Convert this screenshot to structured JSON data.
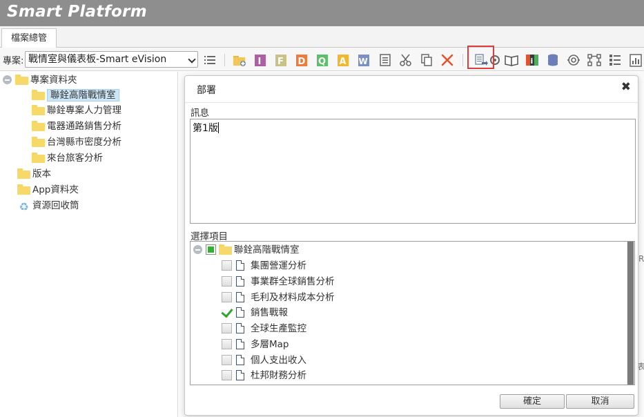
{
  "app": {
    "title": "Smart Platform"
  },
  "tabs": [
    {
      "label": "檔案總管"
    }
  ],
  "toolbar": {
    "project_label": "專案:",
    "project_value": "戰情室與儀表板-Smart eVision",
    "icons": [
      "list-icon",
      "new-folder-icon",
      "new-item-i-icon",
      "new-item-f-icon",
      "new-item-d-icon",
      "new-item-q-icon",
      "new-item-a-icon",
      "new-item-w-icon",
      "properties-icon",
      "cut-icon",
      "copy-icon",
      "delete-icon",
      "deploy-icon",
      "settings-icon",
      "book-icon",
      "info-icon",
      "database-icon",
      "sync-icon",
      "workflow-icon",
      "list-view-icon",
      "report-icon"
    ]
  },
  "sidebar": {
    "root": {
      "label": "專案資料夾"
    },
    "children": [
      {
        "label": "聯銓高階戰情室",
        "selected": true
      },
      {
        "label": "聯銓專案人力管理"
      },
      {
        "label": "電器通路銷售分析"
      },
      {
        "label": "台灣縣市密度分析"
      },
      {
        "label": "來台旅客分析"
      }
    ],
    "others": [
      {
        "label": "版本",
        "icon": "folder-icon"
      },
      {
        "label": "App資料夾",
        "icon": "folder-icon"
      },
      {
        "label": "資源回收筒",
        "icon": "recycle-bin-icon"
      }
    ]
  },
  "background": {
    "fragments": [
      "R",
      "表"
    ]
  },
  "dialog": {
    "title": "部署",
    "message_label": "訊息",
    "message_value": "第1版",
    "select_label": "選擇項目",
    "root_item": "聯銓高階戰情室",
    "items": [
      {
        "label": "集團營運分析",
        "checked": false
      },
      {
        "label": "事業群全球銷售分析",
        "checked": false
      },
      {
        "label": "毛利及材料成本分析",
        "checked": false
      },
      {
        "label": "銷售戰報",
        "checked": true
      },
      {
        "label": "全球生產監控",
        "checked": false
      },
      {
        "label": "多層Map",
        "checked": false
      },
      {
        "label": "個人支出收入",
        "checked": false
      },
      {
        "label": "杜邦財務分析",
        "checked": false
      }
    ],
    "confirm_label": "確定",
    "cancel_label": "取消"
  },
  "colors": {
    "titlebar": "#8e8e8e",
    "highlight": "#e03a3a",
    "selected_bg": "#cde6f7",
    "check_green": "#2fa62f"
  }
}
